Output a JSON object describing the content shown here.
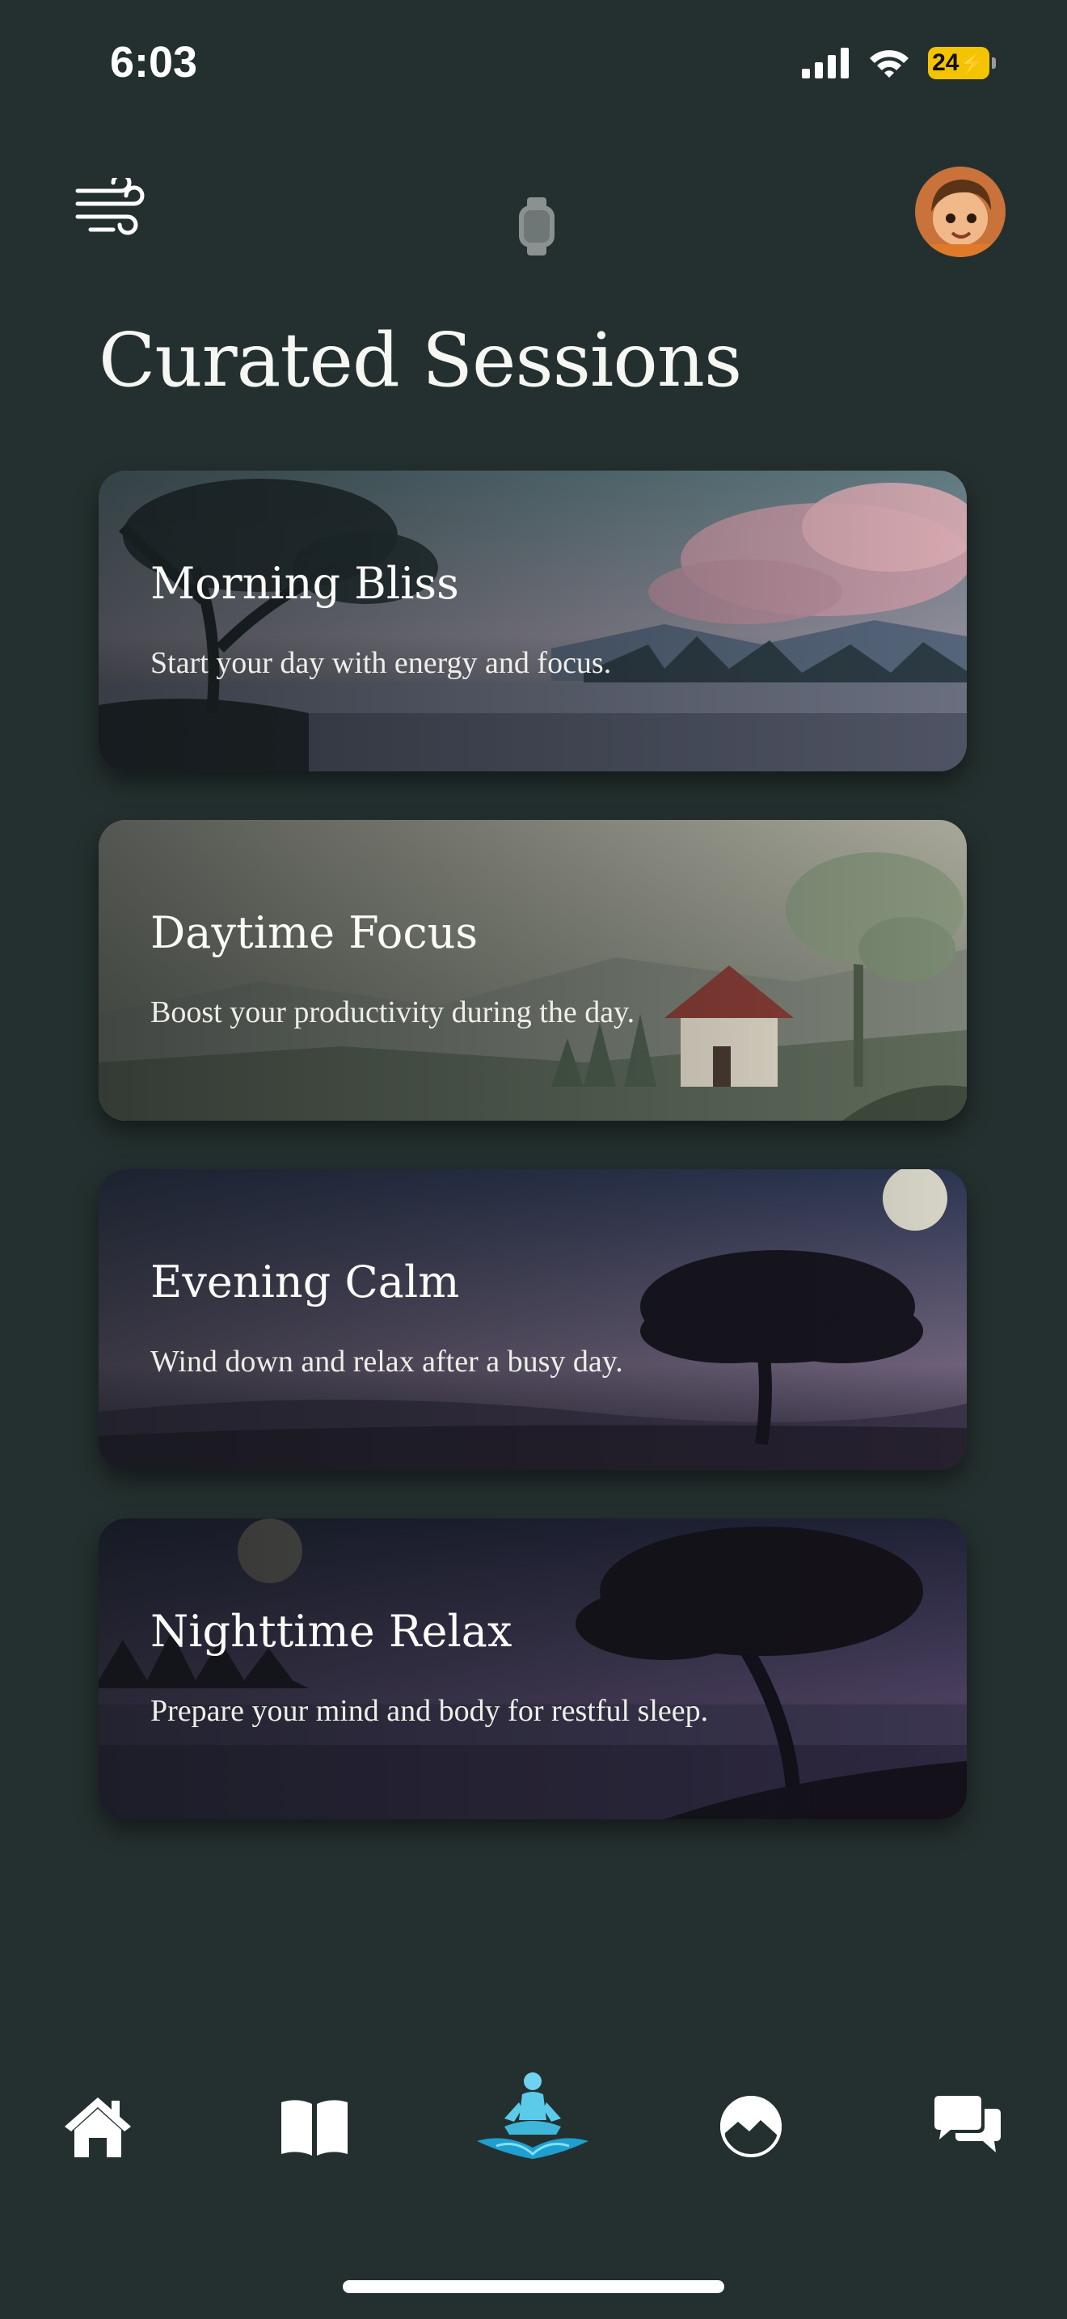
{
  "status": {
    "time": "6:03",
    "battery": "24"
  },
  "header": {
    "title": "Curated Sessions"
  },
  "sessions": [
    {
      "title": "Morning Bliss",
      "subtitle": "Start your day with energy and focus."
    },
    {
      "title": "Daytime Focus",
      "subtitle": "Boost your productivity during the day."
    },
    {
      "title": "Evening Calm",
      "subtitle": "Wind down and relax after a busy day."
    },
    {
      "title": "Nighttime Relax",
      "subtitle": "Prepare your mind and body for restful sleep."
    }
  ],
  "tabs": [
    {
      "icon": "home-icon"
    },
    {
      "icon": "book-icon"
    },
    {
      "icon": "meditation-icon"
    },
    {
      "icon": "landscape-icon"
    },
    {
      "icon": "chat-icon"
    }
  ],
  "colors": {
    "background": "#24302f",
    "accent": "#3fb6d9"
  }
}
